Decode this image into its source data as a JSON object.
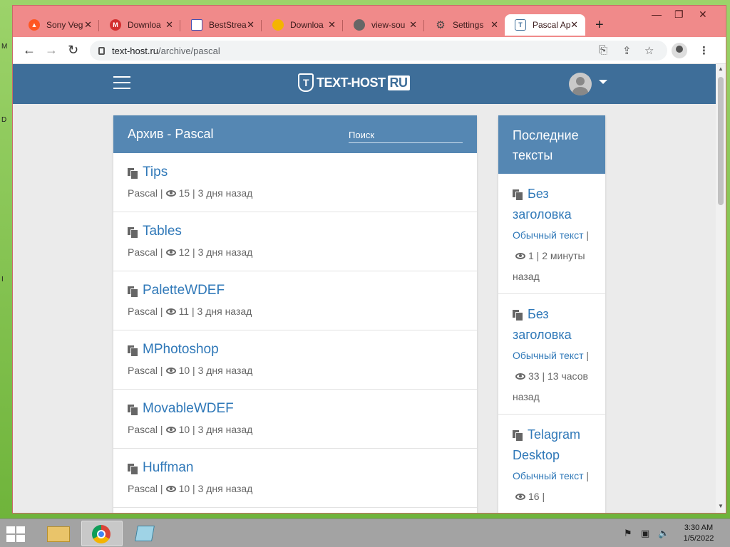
{
  "browser": {
    "tabs": [
      {
        "label": "Sony Veg",
        "fav_color": "#ff5722",
        "fav_glyph": ""
      },
      {
        "label": "Downloa",
        "fav_color": "#d32f2f",
        "fav_glyph": "M"
      },
      {
        "label": "BestStrea",
        "fav_color": "#3f51b5",
        "fav_glyph": ""
      },
      {
        "label": "Downloa",
        "fav_color": "#f4b400",
        "fav_glyph": ""
      },
      {
        "label": "view-sou",
        "fav_color": "#555555",
        "fav_glyph": ""
      },
      {
        "label": "Settings",
        "fav_color": "#555555",
        "fav_glyph": "⚙"
      },
      {
        "label": "Pascal Ap",
        "fav_color": "#3e6e99",
        "fav_glyph": "T"
      }
    ],
    "address": {
      "host": "text-host.ru",
      "path": "/archive/pascal"
    }
  },
  "site": {
    "logo_text": "TEXT-HOST",
    "logo_suffix": "RU",
    "archive_title": "Архив - Pascal",
    "search_placeholder": "Поиск",
    "entries": [
      {
        "title": "Tips",
        "lang": "Pascal",
        "views": "15",
        "age": "3 дня назад"
      },
      {
        "title": "Tables",
        "lang": "Pascal",
        "views": "12",
        "age": "3 дня назад"
      },
      {
        "title": "PaletteWDEF",
        "lang": "Pascal",
        "views": "11",
        "age": "3 дня назад"
      },
      {
        "title": "MPhotoshop",
        "lang": "Pascal",
        "views": "10",
        "age": "3 дня назад"
      },
      {
        "title": "MovableWDEF",
        "lang": "Pascal",
        "views": "10",
        "age": "3 дня назад"
      },
      {
        "title": "Huffman",
        "lang": "Pascal",
        "views": "10",
        "age": "3 дня назад"
      }
    ],
    "sidebar_title": "Последние тексты",
    "recent": [
      {
        "title": "Без заголовка",
        "category": "Обычный текст",
        "views": "1",
        "age": "2 минуты назад"
      },
      {
        "title": "Без заголовка",
        "category": "Обычный текст",
        "views": "33",
        "age": "13 часов назад"
      },
      {
        "title": "Telagram Desktop",
        "category": "Обычный текст",
        "views": "16",
        "age": ""
      }
    ]
  },
  "taskbar": {
    "time": "3:30 AM",
    "date": "1/5/2022"
  }
}
